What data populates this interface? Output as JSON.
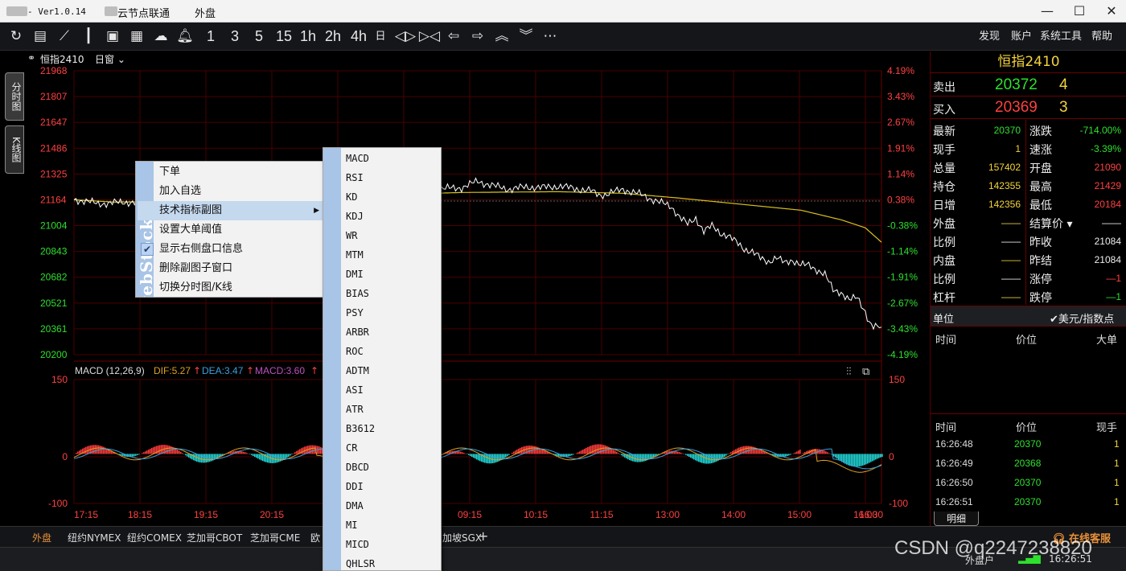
{
  "titlebar": {
    "version": "- Ver1.0.14",
    "app_name": "云节点联通",
    "tab": "外盘"
  },
  "toolbar": {
    "icons": [
      "refresh-icon",
      "document-icon",
      "line-chart-icon",
      "candlestick-icon",
      "image-chart-icon",
      "news-icon",
      "cloud-upload-icon",
      "bell-icon"
    ],
    "periods": [
      "1",
      "3",
      "5",
      "15",
      "1h",
      "2h",
      "4h",
      "日"
    ],
    "nav_icons": [
      "arrows-expand-icon",
      "arrows-compress-icon",
      "arrow-left-icon",
      "arrow-right-icon",
      "double-up-icon",
      "double-down-icon",
      "more-icon"
    ],
    "menus": [
      "发现",
      "账户",
      "系统工具",
      "帮助"
    ]
  },
  "side_tabs": [
    "分时图",
    "K线图"
  ],
  "chart_header": {
    "symbol": "恒指2410",
    "period_select": "日窗"
  },
  "chart_data": {
    "type": "line",
    "main_left_ticks": [
      "21968",
      "21807",
      "21647",
      "21486",
      "21325",
      "21164",
      "21004",
      "20843",
      "20682",
      "20521",
      "20361",
      "20200"
    ],
    "main_right_ticks": [
      "4.19%",
      "3.43%",
      "2.67%",
      "1.91%",
      "1.14%",
      "0.38%",
      "-0.38%",
      "-1.14%",
      "-1.91%",
      "-2.67%",
      "-3.43%",
      "-4.19%"
    ],
    "main_ylim": [
      20200,
      21968
    ],
    "prev_close": 21084,
    "x_ticks": [
      "17:15",
      "18:15",
      "19:15",
      "20:15",
      "21:15",
      "00:00",
      "09:15",
      "10:15",
      "11:15",
      "13:00",
      "14:00",
      "15:00",
      "16:00",
      "16:30"
    ],
    "price_series": [
      [
        0,
        21165
      ],
      [
        0.01,
        21160
      ],
      [
        0.02,
        21150
      ],
      [
        0.03,
        21140
      ],
      [
        0.05,
        21145
      ],
      [
        0.06,
        21150
      ],
      [
        0.075,
        21148
      ],
      [
        0.09,
        21142
      ],
      [
        0.48,
        21240
      ],
      [
        0.5,
        21280
      ],
      [
        0.52,
        21250
      ],
      [
        0.54,
        21230
      ],
      [
        0.56,
        21245
      ],
      [
        0.58,
        21240
      ],
      [
        0.6,
        21250
      ],
      [
        0.62,
        21235
      ],
      [
        0.64,
        21220
      ],
      [
        0.65,
        21195
      ],
      [
        0.66,
        21200
      ],
      [
        0.68,
        21230
      ],
      [
        0.7,
        21200
      ],
      [
        0.72,
        21160
      ],
      [
        0.74,
        21120
      ],
      [
        0.75,
        21060
      ],
      [
        0.76,
        21010
      ],
      [
        0.77,
        21050
      ],
      [
        0.78,
        20970
      ],
      [
        0.79,
        21000
      ],
      [
        0.8,
        20960
      ],
      [
        0.81,
        20940
      ],
      [
        0.82,
        20900
      ],
      [
        0.83,
        20860
      ],
      [
        0.84,
        20840
      ],
      [
        0.85,
        20800
      ],
      [
        0.86,
        20780
      ],
      [
        0.87,
        20805
      ],
      [
        0.88,
        20770
      ],
      [
        0.89,
        20790
      ],
      [
        0.9,
        20760
      ],
      [
        0.91,
        20755
      ],
      [
        0.92,
        20730
      ],
      [
        0.93,
        20700
      ],
      [
        0.94,
        20600
      ],
      [
        0.95,
        20590
      ],
      [
        0.96,
        20540
      ],
      [
        0.97,
        20555
      ],
      [
        0.98,
        20470
      ],
      [
        0.985,
        20400
      ],
      [
        0.99,
        20370
      ],
      [
        1.0,
        20372
      ]
    ],
    "avg_series": [
      [
        0,
        21165
      ],
      [
        0.05,
        21150
      ],
      [
        0.09,
        21152
      ],
      [
        0.48,
        21210
      ],
      [
        0.6,
        21215
      ],
      [
        0.68,
        21205
      ],
      [
        0.75,
        21175
      ],
      [
        0.82,
        21140
      ],
      [
        0.9,
        21100
      ],
      [
        0.95,
        21040
      ],
      [
        0.98,
        20990
      ],
      [
        1.0,
        20900
      ]
    ],
    "macd": {
      "label": "MACD (12,26,9)",
      "dif": "DIF:5.27",
      "dea": "DEA:3.47",
      "macd": "MACD:3.60",
      "ticks_left": [
        "150",
        "0",
        "-100"
      ],
      "ticks_right": [
        "150",
        "0",
        "-100"
      ],
      "ylim": [
        -100,
        150
      ]
    }
  },
  "context_menu": {
    "items": [
      "下单",
      "加入自选",
      "技术指标副图",
      "设置大单阈值",
      "显示右侧盘口信息",
      "删除副图子窗口",
      "切换分时图/K线"
    ],
    "watermark_text": "webStock"
  },
  "submenu": {
    "items": [
      "MACD",
      "RSI",
      "KD",
      "KDJ",
      "WR",
      "MTM",
      "DMI",
      "BIAS",
      "PSY",
      "ARBR",
      "ROC",
      "ADTM",
      "ASI",
      "ATR",
      "B3612",
      "CR",
      "DBCD",
      "DDI",
      "DMA",
      "MI",
      "MICD",
      "QHLSR"
    ]
  },
  "quote_panel": {
    "title": "恒指2410",
    "sell": {
      "label": "卖出",
      "price": "20372",
      "volume": "4"
    },
    "buy": {
      "label": "买入",
      "price": "20369",
      "volume": "3"
    },
    "rows": [
      {
        "l1": "最新",
        "v1": "20370",
        "c1": "#2ee02e",
        "l2": "涨跌",
        "v2": "-714.00%",
        "c2": "#2ee02e"
      },
      {
        "l1": "现手",
        "v1": "1",
        "c1": "#f3d33c",
        "l2": "速涨",
        "v2": "-3.39%",
        "c2": "#2ee02e"
      },
      {
        "l1": "总量",
        "v1": "157402",
        "c1": "#f3d33c",
        "l2": "开盘",
        "v2": "21090",
        "c2": "#ff4040"
      },
      {
        "l1": "持仓",
        "v1": "142355",
        "c1": "#f3d33c",
        "l2": "最高",
        "v2": "21429",
        "c2": "#ff4040"
      },
      {
        "l1": "日增",
        "v1": "142356",
        "c1": "#f3d33c",
        "l2": "最低",
        "v2": "20184",
        "c2": "#ff4040"
      },
      {
        "l1": "外盘",
        "v1": "——",
        "c1": "#f3d33c",
        "l2": "结算价 ▾",
        "v2": "——",
        "c2": "#eeeeee"
      },
      {
        "l1": "比例",
        "v1": "——",
        "c1": "#eeeeee",
        "l2": "昨收",
        "v2": "21084",
        "c2": "#eeeeee"
      },
      {
        "l1": "内盘",
        "v1": "——",
        "c1": "#f3d33c",
        "l2": "昨结",
        "v2": "21084",
        "c2": "#eeeeee"
      },
      {
        "l1": "比例",
        "v1": "——",
        "c1": "#eeeeee",
        "l2": "涨停",
        "v2": "—1",
        "c2": "#ff4040"
      },
      {
        "l1": "杠杆",
        "v1": "——",
        "c1": "#f3d33c",
        "l2": "跌停",
        "v2": "—1",
        "c2": "#2ee02e"
      }
    ],
    "unit_label": "单位",
    "unit_value": "✔美元/指数点",
    "big_order_headers": [
      "时间",
      "价位",
      "大单"
    ],
    "tick_headers": [
      "时间",
      "价位",
      "现手"
    ],
    "ticks": [
      {
        "time": "16:26:48",
        "price": "20370",
        "vol": "1"
      },
      {
        "time": "16:26:49",
        "price": "20368",
        "vol": "1"
      },
      {
        "time": "16:26:50",
        "price": "20370",
        "vol": "1"
      },
      {
        "time": "16:26:51",
        "price": "20370",
        "vol": "1"
      }
    ],
    "detail_tab": "明细"
  },
  "bottom_tabs": [
    "外盘",
    "纽约NYMEX",
    "纽约COMEX",
    "芝加哥CBOT",
    "芝加哥CME",
    "欧",
    "加坡SGX",
    "+"
  ],
  "status": {
    "time": "16:26:51",
    "online_service": "在线客服",
    "outer_user": "外盘户"
  },
  "watermark": "CSDN @q2247238820",
  "colors": {
    "grid": "#5a0000",
    "up": "#ff4040",
    "down": "#2ee02e",
    "accent": "#f3d33c",
    "price_line": "#ffffff",
    "avg_line": "#d9c21e",
    "hist_up": "#ff3c3c",
    "hist_down": "#20d8d8"
  }
}
